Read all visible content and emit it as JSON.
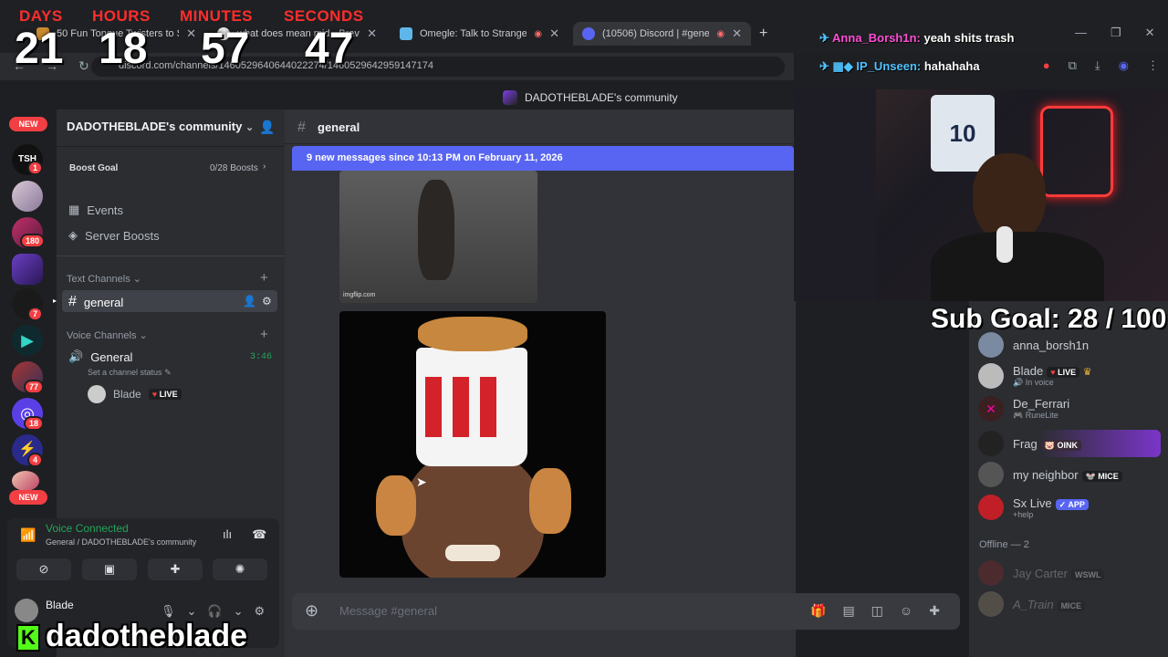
{
  "countdown": {
    "labels": [
      "DAYS",
      "HOURS",
      "MINUTES",
      "SECONDS"
    ],
    "values": [
      "21",
      "18",
      "57",
      "47"
    ]
  },
  "browser": {
    "tabs": [
      {
        "title": "50 Fun Tongue Twisters to Shar"
      },
      {
        "title": "what does mean mid - Brave"
      },
      {
        "title": "Omegle: Talk to Strangers w"
      },
      {
        "title": "(10506) Discord | #general"
      }
    ],
    "url": "discord.com/channels/1460529640644022274/1460529642959147174",
    "window_title": "DADOTHEBLADE's community"
  },
  "stream_chat": [
    {
      "user": "Anna_Borsh1n:",
      "text": "yeah shits trash",
      "color": "#ff4fd8"
    },
    {
      "user": "IP_Unseen:",
      "text": "hahahaha",
      "color": "#4fc3ff"
    }
  ],
  "rail": {
    "new_top": "NEW",
    "new_bottom": "NEW",
    "badges": [
      "1",
      "180",
      "7",
      "77",
      "18",
      "4"
    ],
    "tsh_label": "TSH"
  },
  "sidebar": {
    "server_name": "DADOTHEBLADE's community",
    "boost_goal": "Boost Goal",
    "boost_count": "0/28 Boosts",
    "events": "Events",
    "server_boosts": "Server Boosts",
    "text_channels": "Text Channels",
    "active_channel": "general",
    "voice_channels": "Voice Channels",
    "voice_channel": "General",
    "voice_time": "3:46",
    "channel_status": "Set a channel status",
    "voice_user": "Blade",
    "live": "LIVE"
  },
  "voice_panel": {
    "status": "Voice Connected",
    "location": "General / DADOTHEBLADE's community",
    "user": "Blade",
    "user_sub": "In voice"
  },
  "chat": {
    "channel": "general",
    "banner": "9 new messages since 10:13 PM on February 11, 2026",
    "gif_credit": "imgflip.com",
    "placeholder": "Message #general"
  },
  "members": [
    {
      "name": "anna_borsh1n",
      "sub": "",
      "tag": ""
    },
    {
      "name": "Blade",
      "sub": "In voice",
      "tag": "LIVE"
    },
    {
      "name": "De_Ferrari",
      "sub": "RuneLite",
      "tag": ""
    },
    {
      "name": "Frag",
      "sub": "",
      "tag": "OINK"
    },
    {
      "name": "my neighbor",
      "sub": "",
      "tag": "MICE"
    },
    {
      "name": "Sx Live",
      "sub": "+help",
      "tag": "APP"
    }
  ],
  "offline": {
    "header": "Offline — 2",
    "items": [
      {
        "name": "Jay Carter",
        "tag": "WSWL"
      },
      {
        "name": "A_Train",
        "tag": "MICE"
      }
    ]
  },
  "overlay": {
    "sub_goal": "Sub Goal:  28 / 100",
    "handle": "dadotheblade",
    "jersey_number": "10"
  }
}
